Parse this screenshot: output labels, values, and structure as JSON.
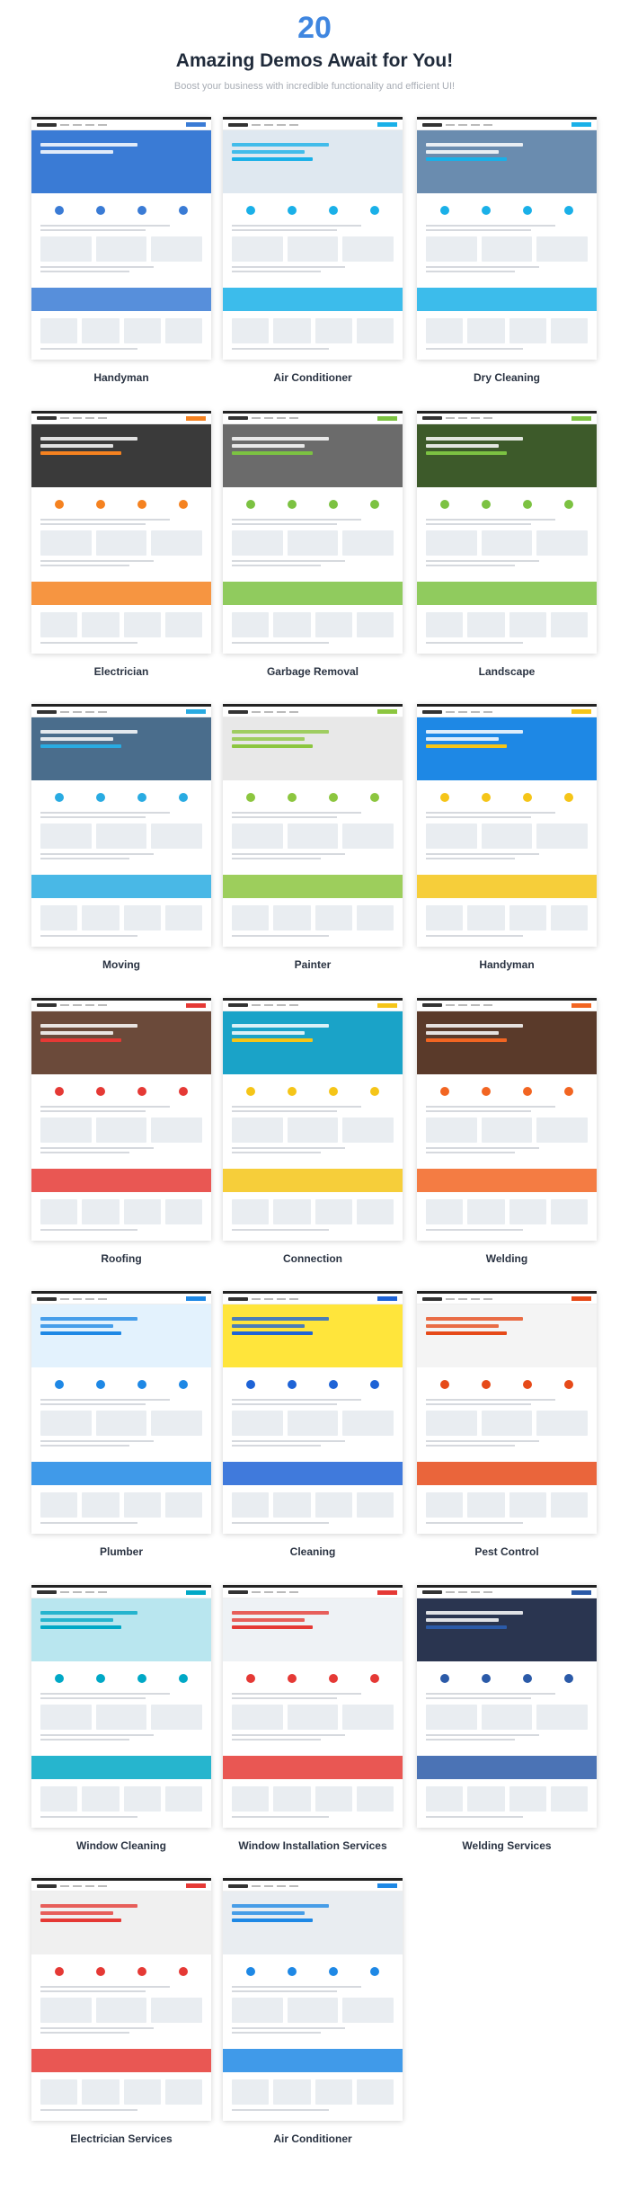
{
  "header": {
    "count": "20",
    "title": "Amazing Demos Await for You!",
    "subtitle": "Boost your business with incredible functionality and efficient UI!"
  },
  "demos": [
    {
      "label": "Handyman",
      "hero": "#3a7bd5",
      "accent": "#3a7bd5"
    },
    {
      "label": "Air Conditioner",
      "hero": "#dfe8f0",
      "accent": "#1ab0e8"
    },
    {
      "label": "Dry Cleaning",
      "hero": "#6a8caf",
      "accent": "#1ab0e8"
    },
    {
      "label": "Electrician",
      "hero": "#3a3a3a",
      "accent": "#f58220"
    },
    {
      "label": "Garbage Removal",
      "hero": "#6b6b6b",
      "accent": "#7cc242"
    },
    {
      "label": "Landscape",
      "hero": "#3d5a2a",
      "accent": "#7cc242"
    },
    {
      "label": "Moving",
      "hero": "#4a6d8c",
      "accent": "#29abe2"
    },
    {
      "label": "Painter",
      "hero": "#e8e8e8",
      "accent": "#8cc63f"
    },
    {
      "label": "Handyman",
      "hero": "#1e88e5",
      "accent": "#f5c518"
    },
    {
      "label": "Roofing",
      "hero": "#6b4a3a",
      "accent": "#e53935"
    },
    {
      "label": "Connection",
      "hero": "#1aa3c8",
      "accent": "#f5c518"
    },
    {
      "label": "Welding",
      "hero": "#5a3a2a",
      "accent": "#f26522"
    },
    {
      "label": "Plumber",
      "hero": "#e3f2fd",
      "accent": "#1e88e5"
    },
    {
      "label": "Cleaning",
      "hero": "#ffe53b",
      "accent": "#1e63d6"
    },
    {
      "label": "Pest Control",
      "hero": "#f4f4f4",
      "accent": "#e64a19"
    },
    {
      "label": "Window Cleaning",
      "hero": "#b9e6ef",
      "accent": "#00a8c6"
    },
    {
      "label": "Window Installation Services",
      "hero": "#eef2f5",
      "accent": "#e53935"
    },
    {
      "label": "Welding Services",
      "hero": "#2a3550",
      "accent": "#2b5aa8"
    },
    {
      "label": "Electrician Services",
      "hero": "#f0f0f0",
      "accent": "#e53935"
    },
    {
      "label": "Air Conditioner",
      "hero": "#e9edf1",
      "accent": "#1e88e5"
    }
  ]
}
